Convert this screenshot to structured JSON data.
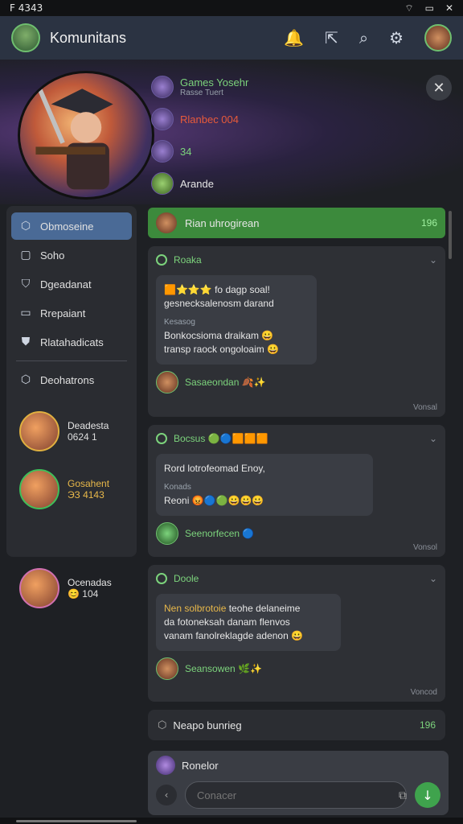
{
  "status": {
    "left": "F 4343"
  },
  "app": {
    "title": "Komunitans"
  },
  "hero_list": [
    {
      "name": "Games Yosehr",
      "sub": "Rasse Tuert",
      "color": "#7cd37c"
    },
    {
      "name": "Rlanbec 004",
      "sub": "",
      "color": "#e85a3a"
    },
    {
      "name": "34",
      "sub": "",
      "color": "#7cd37c"
    },
    {
      "name": "Arande",
      "sub": "",
      "color": "#e6e6e6"
    }
  ],
  "sidebar": {
    "items": [
      {
        "label": "Obmoseine",
        "icon": "tag-icon",
        "glyph": "⬡",
        "active": true
      },
      {
        "label": "Soho",
        "icon": "image-icon",
        "glyph": "▢",
        "active": false
      },
      {
        "label": "Dgeadanat",
        "icon": "shield-icon",
        "glyph": "⛉",
        "active": false
      },
      {
        "label": "Rrepaiant",
        "icon": "list-icon",
        "glyph": "▭",
        "active": false
      },
      {
        "label": "Rlatahadicats",
        "icon": "shirt-icon",
        "glyph": "⛊",
        "active": false
      }
    ],
    "footer_item": {
      "label": "Deohatrons",
      "icon": "tag-icon",
      "glyph": "⬡"
    },
    "users": [
      {
        "name": "Deadesta",
        "stat": "0624 1"
      },
      {
        "name": "Gosahent",
        "stat": "ЭЗ 4143"
      },
      {
        "name": "Ocenadas",
        "stat": "😊 104"
      }
    ]
  },
  "main": {
    "banner": {
      "label": "Rian uhrogirean",
      "count": "196"
    },
    "card1": {
      "head": "Roaka",
      "bubble_lines": [
        "🟧⭐⭐⭐ fo dagp soal!",
        "gesnecksalenosm darand"
      ],
      "bubble_small": "Kesasog",
      "bubble_lines2": [
        "Bonkocsioma draikam 😀",
        "transp raock ongoloaim 😀"
      ],
      "foot": "Sasaeondan 🍂✨",
      "meta": "Vonsal"
    },
    "card2": {
      "head": "Bocsus 🟢🔵🟧🟧🟧",
      "bubble_lines": [
        "Rord lotrofeomad Enoy,"
      ],
      "bubble_small": "Konads",
      "bubble_lines2": [
        "Reoni 😡🔵🟢😀😀😀"
      ],
      "foot": "Seenorfecen 🔵",
      "meta": "Vonsol"
    },
    "card3": {
      "head": "Doole",
      "bubble_warn": "Nen solbrotoie",
      "bubble_lines_after": " teohe delaneime",
      "bubble_lines": [
        "da fotoneksah danam flenvos",
        "vanam fanolreklagde adenon 😀"
      ],
      "foot": "Seansowen 🌿✨",
      "meta": "Voncod"
    },
    "bottom_row": {
      "label": "Neapo bunrieg",
      "count": "196"
    }
  },
  "composer": {
    "user": "Ronelor",
    "placeholder": "Conacer"
  }
}
